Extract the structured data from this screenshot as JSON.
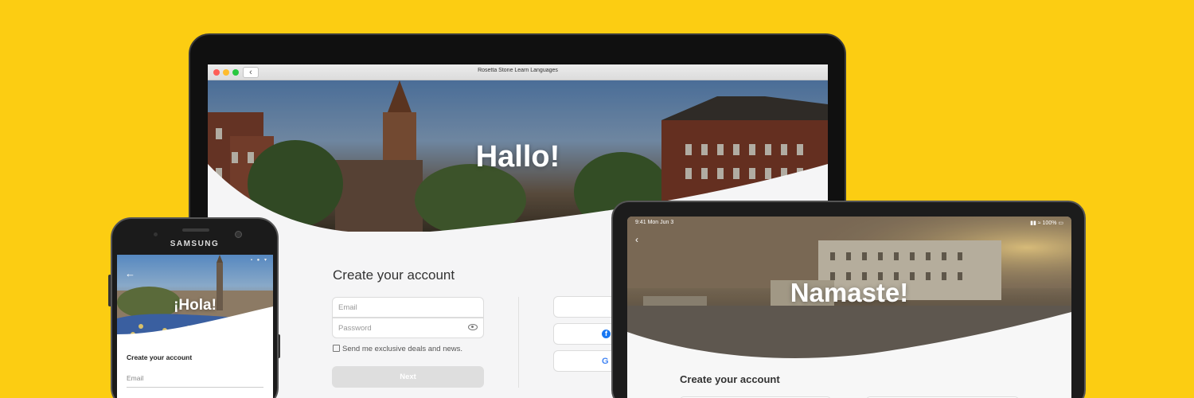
{
  "colors": {
    "background": "#fccd12"
  },
  "laptop": {
    "window_title": "Rosetta Stone Learn Languages",
    "back_icon": "chevron-left-icon",
    "hero_title": "Hallo!",
    "form_title": "Create your account",
    "email_placeholder": "Email",
    "password_placeholder": "Password",
    "checkbox_label": "Send me exclusive deals and news.",
    "next_label": "Next",
    "social_buttons": [
      {
        "icon": "apple-icon",
        "glyph": ""
      },
      {
        "icon": "facebook-icon",
        "glyph": "f"
      },
      {
        "icon": "google-icon",
        "glyph": "G"
      }
    ]
  },
  "phone": {
    "brand": "SAMSUNG",
    "status_icons": "▪ ● ▾",
    "back_glyph": "←",
    "hero_title": "¡Hola!",
    "form_title": "Create your account",
    "email_placeholder": "Email"
  },
  "tablet": {
    "time": "9:41  Mon Jun 3",
    "battery": "▮▮ ≈ 100% ▭",
    "back_glyph": "‹",
    "hero_title": "Namaste!",
    "form_title": "Create your account"
  }
}
